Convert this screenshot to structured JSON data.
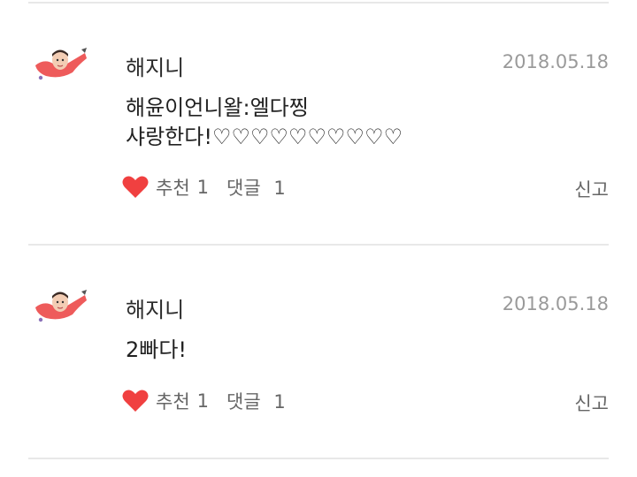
{
  "comments": [
    {
      "author": "해지니",
      "date": "2018.05.18",
      "lines": [
        "해윤이언니왈:엘다찡",
        "샤랑한다!♡♡♡♡♡♡♡♡♡♡"
      ],
      "recommend_label": "추천",
      "recommend_count": "1",
      "reply_label": "댓글",
      "reply_count": "1",
      "report_label": "신고"
    },
    {
      "author": "해지니",
      "date": "2018.05.18",
      "lines": [
        "2빠다!"
      ],
      "recommend_label": "추천",
      "recommend_count": "1",
      "reply_label": "댓글",
      "reply_count": "1",
      "report_label": "신고"
    }
  ],
  "colors": {
    "heart": "#f04040",
    "date": "#9a9a9a",
    "divider": "#e8e8e8",
    "avatar_shirt": "#ee5b5b"
  },
  "icons": [
    "avatar-sticker",
    "heart-icon"
  ]
}
